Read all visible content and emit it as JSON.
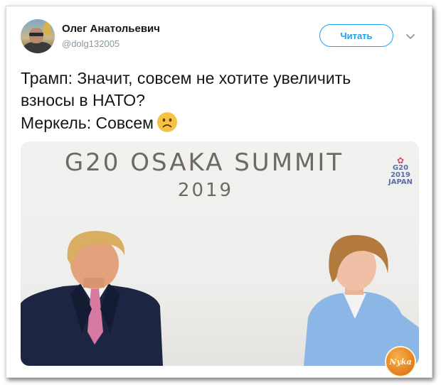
{
  "tweet": {
    "author": {
      "name": "Олег Анатольевич",
      "handle": "@dolg132005"
    },
    "follow_label": "Читать",
    "text_lines": [
      "Трамп: Значит, совсем не хотите увеличить",
      "взносы в НАТО?",
      "Меркель: Совсем"
    ],
    "emoji": "slightly-frowning-face"
  },
  "photo": {
    "banner_title": "G20 OSAKA SUMMIT",
    "banner_year": "2019",
    "logo_lines": [
      "G20",
      "2019",
      "JAPAN"
    ],
    "watermark": "Nyka"
  },
  "colors": {
    "accent": "#1da1f2",
    "text": "#14171a",
    "muted": "#8899a6",
    "emoji": "#f5c242"
  }
}
